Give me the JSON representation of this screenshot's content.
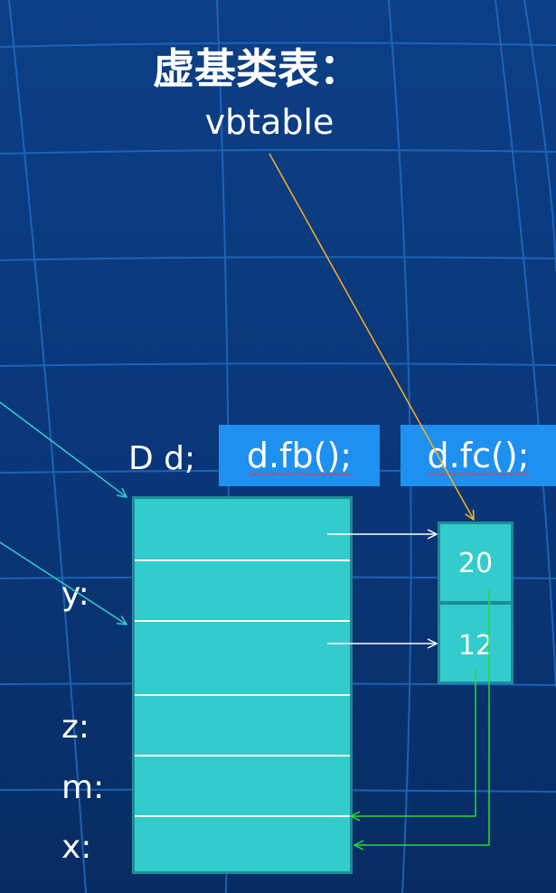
{
  "title": "虚基类表：",
  "subtitle": "vbtable",
  "declaration": "D d;",
  "calls": [
    {
      "label": "d.fb();"
    },
    {
      "label": "d.fc();"
    }
  ],
  "object_slots": [
    {
      "label": ""
    },
    {
      "label": "y:"
    },
    {
      "label": ""
    },
    {
      "label": "z:"
    },
    {
      "label": "m:"
    },
    {
      "label": "x:"
    }
  ],
  "vbtable_entries": [
    {
      "value": "20"
    },
    {
      "value": "12"
    }
  ],
  "colors": {
    "background": "#0a3678",
    "cell_fill": "#33cccc",
    "cell_border": "#1e8c98",
    "call_box": "#1e90f0",
    "pointer_arrow": "#ffffff",
    "offset_arrow": "#22dd33",
    "label_arrow": "#ffb020",
    "incoming_arrow": "#33cccc"
  }
}
